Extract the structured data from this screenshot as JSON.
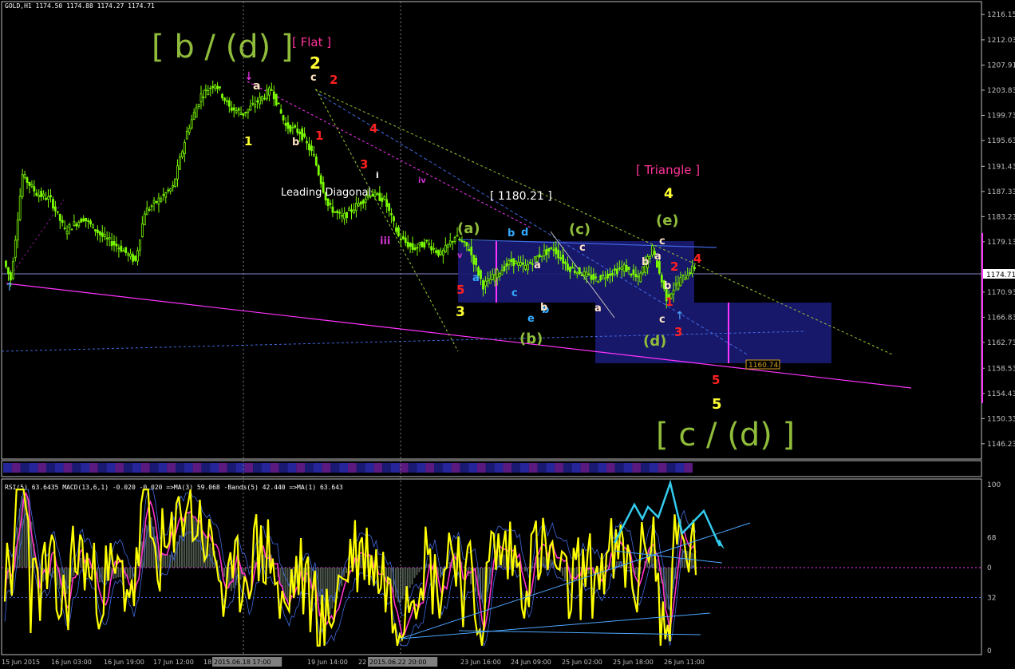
{
  "chart_data": {
    "type": "candlestick",
    "symbol_header": "GOLD,H1  1174.50 1174.88 1174.27 1174.71",
    "last_price_label": "1174.71",
    "price_axis": {
      "ylim": [
        1144.0,
        1218.0
      ],
      "ticks": [
        "1216.15",
        "1212.03",
        "1207.91",
        "1203.83",
        "1199.73",
        "1195.63",
        "1191.43",
        "1187.33",
        "1183.23",
        "1179.13",
        "1174.71",
        "1170.93",
        "1166.83",
        "1162.73",
        "1158.53",
        "1154.43",
        "1150.33",
        "1146.23"
      ],
      "tick_values": [
        1216.15,
        1212.03,
        1207.91,
        1203.83,
        1199.73,
        1195.63,
        1191.43,
        1187.33,
        1183.23,
        1179.13,
        1174.71,
        1170.93,
        1166.83,
        1162.73,
        1158.53,
        1154.43,
        1150.33,
        1146.23
      ]
    },
    "time_axis": {
      "labels": [
        "15 Jun 2015",
        "16 Jun 03:00",
        "16 Jun 19:00",
        "17 Jun 12:00",
        "18 Jun 05:00",
        "2015.06.18 17:00",
        "19 Jun 14:00",
        "22 Jun 06:00",
        "2015.06.22 20:00",
        "23 Jun 16:00",
        "24 Jun 09:00",
        "25 Jun 02:00",
        "25 Jun 18:00",
        "26 Jun 11:00"
      ],
      "highlighted": [
        "2015.06.18 17:00",
        "2015.06.22 20:00"
      ]
    },
    "price_path": {
      "description": "approximate close path (bar index, price)",
      "points": [
        [
          0,
          1176
        ],
        [
          3,
          1173
        ],
        [
          8,
          1190
        ],
        [
          14,
          1187
        ],
        [
          20,
          1186
        ],
        [
          26,
          1181
        ],
        [
          34,
          1183
        ],
        [
          42,
          1180
        ],
        [
          50,
          1178
        ],
        [
          56,
          1176
        ],
        [
          60,
          1184
        ],
        [
          66,
          1186
        ],
        [
          72,
          1188
        ],
        [
          78,
          1197
        ],
        [
          84,
          1203
        ],
        [
          90,
          1205
        ],
        [
          96,
          1201
        ],
        [
          102,
          1200
        ],
        [
          108,
          1202
        ],
        [
          114,
          1204
        ],
        [
          120,
          1198
        ],
        [
          126,
          1197
        ],
        [
          132,
          1193
        ],
        [
          138,
          1185
        ],
        [
          144,
          1183
        ],
        [
          150,
          1185
        ],
        [
          156,
          1187
        ],
        [
          162,
          1186
        ],
        [
          168,
          1180
        ],
        [
          174,
          1178
        ],
        [
          180,
          1179
        ],
        [
          186,
          1177
        ],
        [
          192,
          1180
        ],
        [
          198,
          1178
        ],
        [
          204,
          1172
        ],
        [
          210,
          1174
        ],
        [
          216,
          1176
        ],
        [
          222,
          1175
        ],
        [
          228,
          1177
        ],
        [
          234,
          1178
        ],
        [
          240,
          1175
        ],
        [
          246,
          1174
        ],
        [
          252,
          1173
        ],
        [
          258,
          1174
        ],
        [
          264,
          1175
        ],
        [
          270,
          1173
        ],
        [
          276,
          1178
        ],
        [
          282,
          1170
        ],
        [
          288,
          1173
        ],
        [
          294,
          1175
        ]
      ]
    },
    "annotations": {
      "wave_b_d": "[ b / (d) ]",
      "flat": "[ Flat ]",
      "leading_diagonal": "Leading Diagonal",
      "level_1180": "[ 1180.21 ]",
      "triangle": "[ Triangle ]",
      "wave_c_d": "[ c / (d) ]",
      "target_label": "1160.74",
      "wave_labels": [
        {
          "t": "1",
          "c": "#ffff33"
        },
        {
          "t": "2",
          "c": "#ffff33"
        },
        {
          "t": "a",
          "c": "#ffe4c4"
        },
        {
          "t": "b",
          "c": "#ffe4c4"
        },
        {
          "t": "c",
          "c": "#ffe4c4"
        },
        {
          "t": "1",
          "c": "#ff2020"
        },
        {
          "t": "2",
          "c": "#ff2020"
        },
        {
          "t": "3",
          "c": "#ff2020"
        },
        {
          "t": "4",
          "c": "#ff2020"
        },
        {
          "t": "5",
          "c": "#ff2020"
        },
        {
          "t": "i",
          "c": "#ffffff"
        },
        {
          "t": "iii",
          "c": "#cc33cc"
        },
        {
          "t": "iv",
          "c": "#cc33cc"
        },
        {
          "t": "v",
          "c": "#cc33cc"
        },
        {
          "t": "(a)",
          "c": "#8fbc3a"
        },
        {
          "t": "(b)",
          "c": "#8fbc3a"
        },
        {
          "t": "(c)",
          "c": "#8fbc3a"
        },
        {
          "t": "(d)",
          "c": "#8fbc3a"
        },
        {
          "t": "(e)",
          "c": "#8fbc3a"
        },
        {
          "t": "3",
          "c": "#ffff33"
        },
        {
          "t": "4",
          "c": "#ffff33"
        },
        {
          "t": "5",
          "c": "#ffff33"
        },
        {
          "t": "a",
          "c": "#33aaff"
        },
        {
          "t": "b",
          "c": "#33aaff"
        },
        {
          "t": "c",
          "c": "#33aaff"
        },
        {
          "t": "d",
          "c": "#33aaff"
        },
        {
          "t": "e",
          "c": "#33aaff"
        },
        {
          "t": "a",
          "c": "#ffe4c4"
        },
        {
          "t": "b",
          "c": "#ffe4c4"
        },
        {
          "t": "c",
          "c": "#ffe4c4"
        },
        {
          "t": "a",
          "c": "#ffe4c4"
        },
        {
          "t": "b",
          "c": "#ffe4c4"
        },
        {
          "t": "c",
          "c": "#ffe4c4"
        },
        {
          "t": "1",
          "c": "#ff2020"
        },
        {
          "t": "2",
          "c": "#ff2020"
        },
        {
          "t": "3",
          "c": "#ff2020"
        },
        {
          "t": "4",
          "c": "#ff2020"
        },
        {
          "t": "5",
          "c": "#ff2020"
        }
      ]
    },
    "indicator_header": "RSI(5) 63.6435  MACD(13,6,1) -0.020 -0.020  =>MA(3) 59.068  -Bands(5) 42.440  =>MA(1) 63.643",
    "indicator_axis": {
      "ticks": [
        "100",
        "68",
        "0",
        "32",
        "0"
      ],
      "tick_values": [
        100,
        68,
        50,
        32,
        0
      ]
    },
    "colors": {
      "background": "#000000",
      "grid": "#c0c0c0",
      "candle": "#7cfc00",
      "box": "#191970",
      "trendline_magenta": "#ff33ff",
      "trendline_blue": "#4169e1",
      "rsi": "#ffff00",
      "ma": "#ff33cc",
      "histogram": "#708070",
      "arrow": "#33ccee"
    }
  }
}
